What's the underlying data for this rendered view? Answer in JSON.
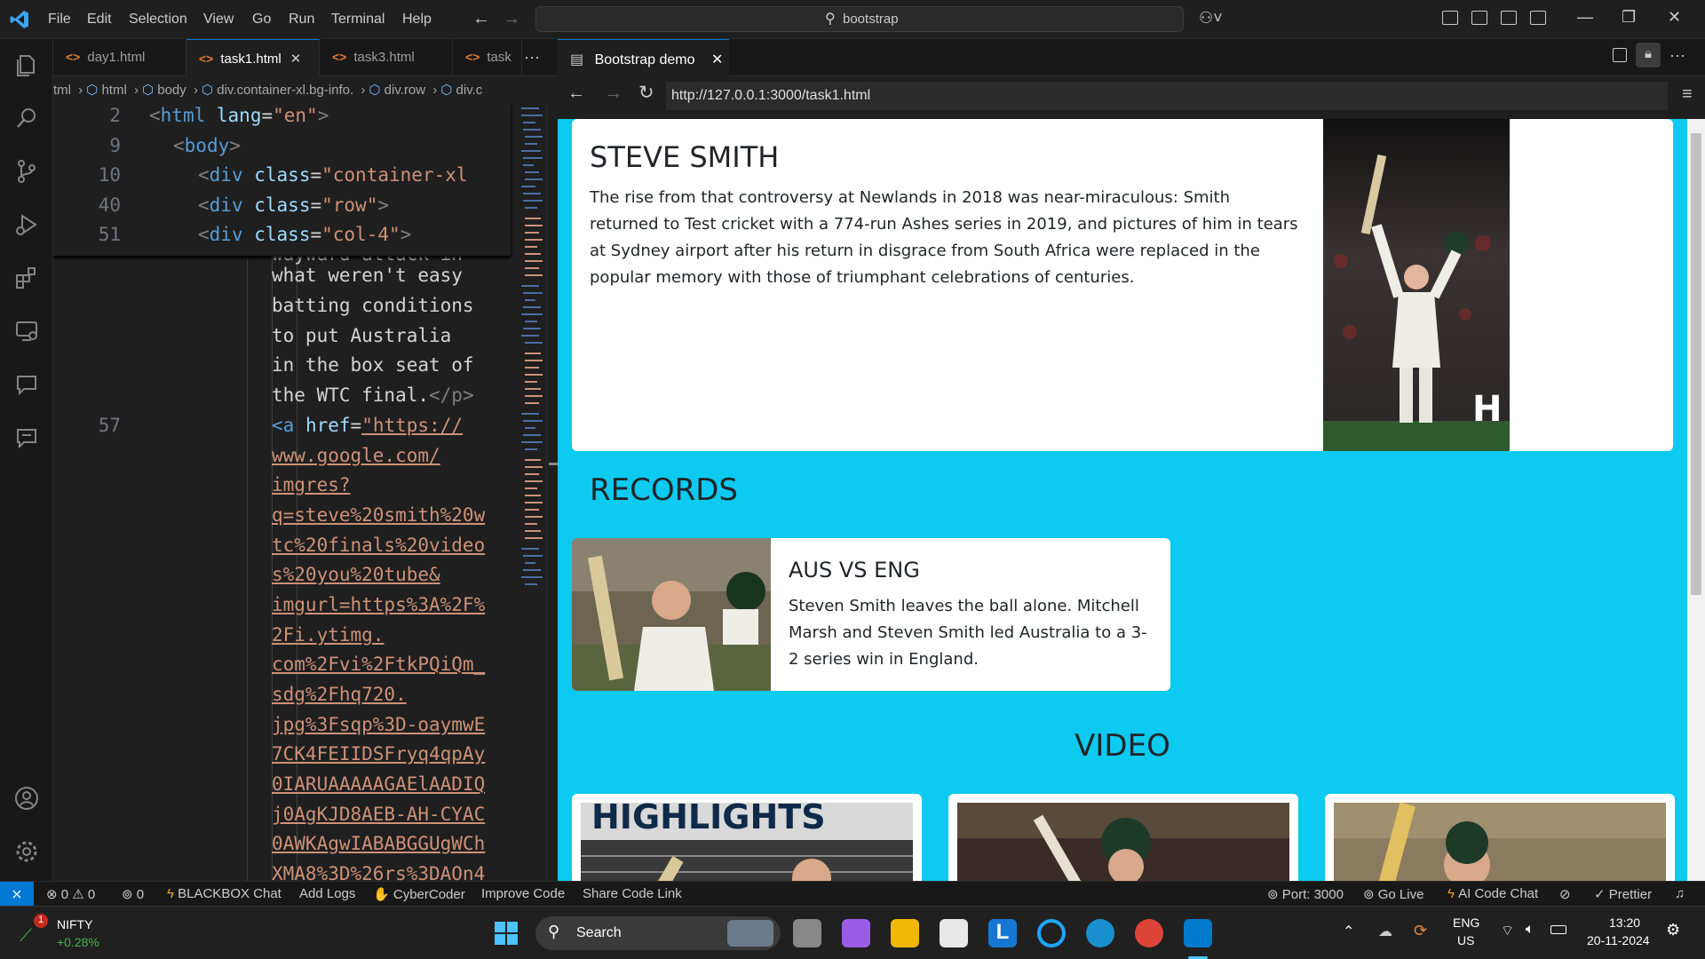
{
  "titlebar": {
    "menu": [
      "File",
      "Edit",
      "Selection",
      "View",
      "Go",
      "Run",
      "Terminal",
      "Help"
    ],
    "search_text": "bootstrap"
  },
  "editor": {
    "tabs": [
      "day1.html",
      "task1.html",
      "task3.html",
      "task"
    ],
    "breadcrumb": [
      "tml",
      "html",
      "body",
      "div.container-xl.bg-info.",
      "div.row",
      "div.c"
    ],
    "sticky_lines": [
      {
        "ln": "2",
        "tag": "html",
        "attr": "lang",
        "val": "\"en\""
      },
      {
        "ln": "9",
        "tag": "body"
      },
      {
        "ln": "10",
        "tag": "div",
        "attr": "class",
        "val": "\"container-xl"
      },
      {
        "ln": "40",
        "tag": "div",
        "attr": "class",
        "val": "\"row\""
      },
      {
        "ln": "51",
        "tag": "div",
        "attr": "class",
        "val": "\"col-4\""
      }
    ],
    "text_lines": [
      "what weren't easy",
      "batting conditions",
      "to put Australia",
      "in the box seat of",
      "the WTC final."
    ],
    "close_p": "</p>",
    "line_57": "57",
    "a_tag": "<a",
    "href_attr": "href",
    "url_lines": [
      "\"https://",
      "www.google.com/",
      "imgres?",
      "q=steve%20smith%20w",
      "tc%20finals%20video",
      "s%20you%20tube&",
      "imgurl=https%3A%2F%",
      "2Fi.ytimg.",
      "com%2Fvi%2FtkPQiQm_",
      "sdg%2Fhq720.",
      "jpg%3Fsqp%3D-oaymwE",
      "7CK4FEIIDSFryq4qpAy",
      "0IARUAAAAAGAElAADIQ",
      "j0AgKJD8AEB-AH-CYAC",
      "0AWKAgwIABABGGUgWCh",
      "XMA8%3D%26rs%3DAOn4"
    ]
  },
  "browser": {
    "tab_title": "Bootstrap demo",
    "url": "http://127.0.0.1:3000/task1.html",
    "hero": {
      "title": "STEVE SMITH",
      "text": "The rise from that controversy at Newlands in 2018 was near-miraculous: Smith returned to Test cricket with a 774-run Ashes series in 2019, and pictures of him in tears at Sydney airport after his return in disgrace from South Africa were replaced in the popular memory with those of triumphant celebrations of centuries."
    },
    "records_heading": "RECORDS",
    "record_card": {
      "title": "AUS VS ENG",
      "text": "Steven Smith leaves the ball alone. Mitchell Marsh and Steven Smith led Australia to a 3-2 series win in England."
    },
    "video_heading": "VIDEO",
    "video_thumb_text": "HIGHLIGHTS"
  },
  "statusbar": {
    "errors": "0",
    "warnings": "0",
    "ports": "0",
    "left": [
      "BLACKBOX Chat",
      "Add Logs",
      "CyberCoder",
      "Improve Code",
      "Share Code Link"
    ],
    "port": "Port: 3000",
    "golive": "Go Live",
    "aichat": "AI Code Chat",
    "prettier": "Prettier"
  },
  "taskbar": {
    "stock_name": "NIFTY",
    "stock_change": "+0.28%",
    "stock_badge": "1",
    "search": "Search",
    "lang": "ENG",
    "region": "US",
    "time": "13:20",
    "date": "20-11-2024"
  },
  "colors": {
    "accent": "#0078d4",
    "page_bg": "#0dcaf0",
    "html_icon": "#e37933"
  }
}
